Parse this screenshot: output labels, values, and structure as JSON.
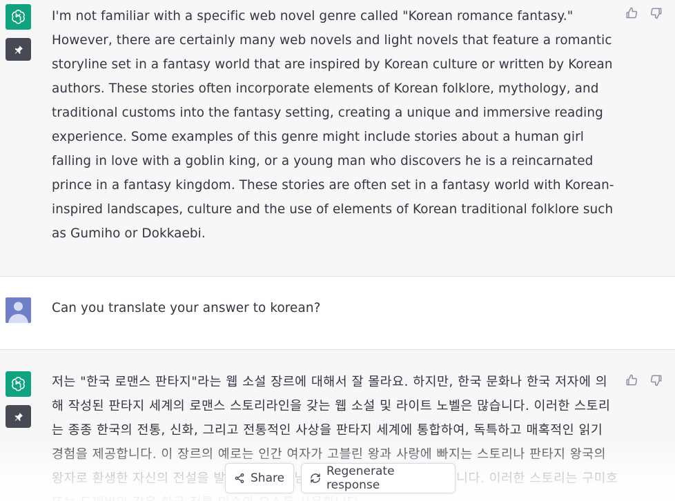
{
  "messages": [
    {
      "role": "assistant",
      "avatar_icon": "openai-logo-icon",
      "pin_icon": "pin-icon",
      "text": "I'm not familiar with a specific web novel genre called \"Korean romance fantasy.\" However, there are certainly many web novels and light novels that feature a romantic storyline set in a fantasy world that are inspired by Korean culture or written by Korean authors. These stories often incorporate elements of Korean folklore, mythology, and traditional customs into the fantasy setting, creating a unique and immersive reading experience. Some examples of this genre might include stories about a human girl falling in love with a goblin king, or a young man who discovers he is a reincarnated prince in a fantasy kingdom. These stories are often set in a fantasy world with Korean-inspired landscapes, culture and the use of elements of Korean traditional folklore such as Gumiho or Dokkaebi."
    },
    {
      "role": "user",
      "avatar_icon": "user-avatar-icon",
      "text": "Can you translate your answer to korean?"
    },
    {
      "role": "assistant",
      "avatar_icon": "openai-logo-icon",
      "pin_icon": "pin-icon",
      "text": "저는 \"한국 로맨스 판타지\"라는 웹 소설 장르에 대해서 잘 몰라요. 하지만, 한국 문화나 한국 저자에 의해 작성된 판타지 세계의 로맨스 스토리라인을 갖는 웹 소설 및 라이트 노벨은 많습니다. 이러한 스토리는 종종 한국의 전통, 신화, 그리고 전통적인 사상을 판타지 세계에 통합하여, 독특하고 매혹적인 읽기 경험을 제공합니다. 이 장르의 예로는 인간 여자가 고블린 왕과 사랑에 빠지는 스토리나 판타지 왕국의 왕자로 환생한 자신의 전설을 발견하는 젊은 남자에 대한 스토리 등이 있습니다. 이러한 스토리는 구미호 또는 도깨비와 같은 한국 전통 민속의 요소를 사용합니다."
    }
  ],
  "actions": {
    "share_label": "Share",
    "regenerate_label": "Regenerate response"
  },
  "icons": {
    "thumbs_up": "thumbs-up-icon",
    "thumbs_down": "thumbs-down-icon",
    "share": "share-icon",
    "regenerate": "refresh-icon"
  },
  "colors": {
    "accent": "#10a37f",
    "pin_bg": "#474a55",
    "user_avatar": "#6f7fc7",
    "assistant_bg": "#f7f7f8"
  }
}
